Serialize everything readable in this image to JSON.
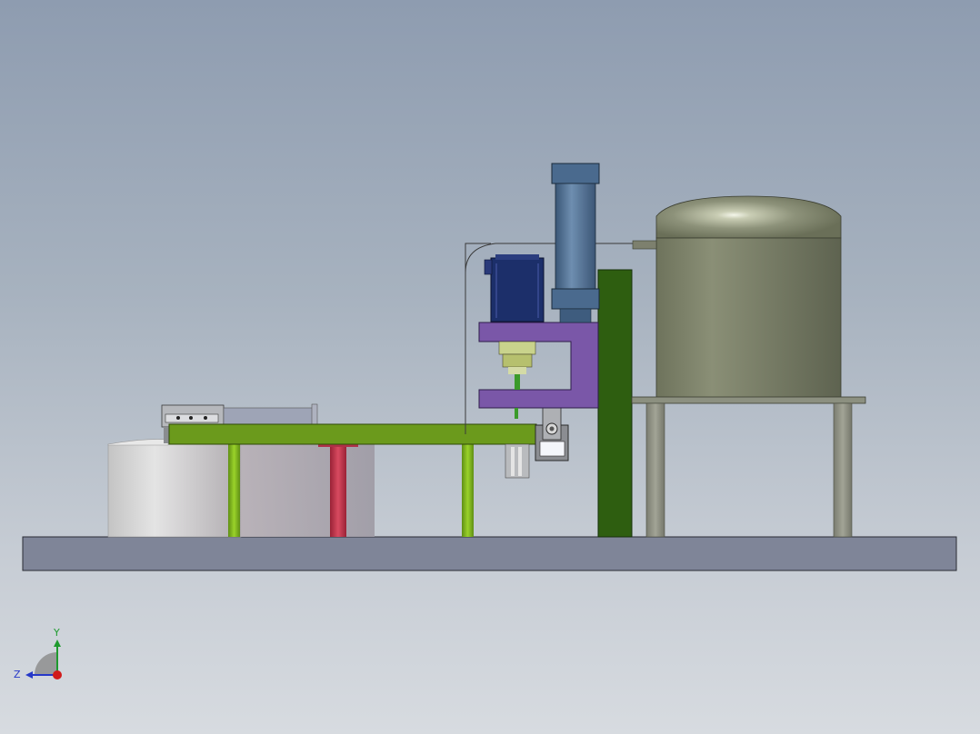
{
  "viewport": {
    "background_top": "#8e9cb0",
    "background_bottom": "#d7dbe0"
  },
  "triad": {
    "y_label": "Y",
    "z_label": "Z",
    "y_color": "#1e9a2e",
    "z_color": "#2638c8",
    "x_color": "#d11a1a"
  },
  "colors": {
    "base_plate": "#7f8598",
    "table_green": "#6b9a1c",
    "leg_green": "#7fb61e",
    "post_dark_green": "#2e5e10",
    "bracket_purple": "#7a57a8",
    "motor_blue": "#1c2f6a",
    "cylinder_blue": "#4a6a8e",
    "tank_olive": "#7c8268",
    "red_post": "#c03348",
    "drum_white": "#dcdcdc"
  }
}
